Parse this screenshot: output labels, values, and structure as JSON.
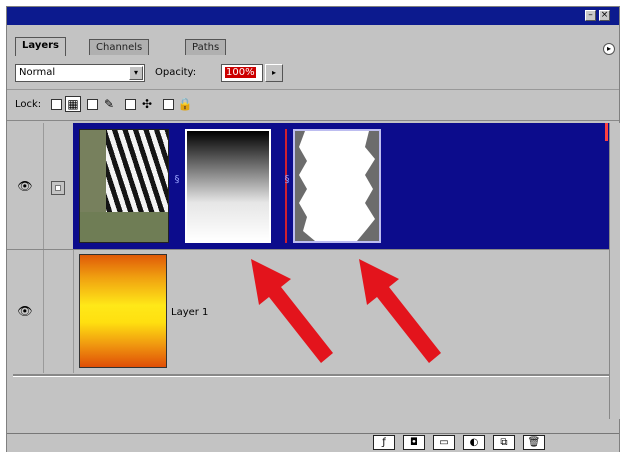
{
  "tabs": [
    "Layers",
    "Channels",
    "Paths"
  ],
  "blend_mode": "Normal",
  "opacity": {
    "label": "Opacity:",
    "value": "100%"
  },
  "lock": {
    "label": "Lock:"
  },
  "layers": [
    {
      "name": "",
      "selected": true,
      "visible": true
    },
    {
      "name": "Layer 1",
      "selected": false,
      "visible": true
    }
  ],
  "colors": {
    "titlebar": "#0c1a8e",
    "selection": "#0c0c8c",
    "panel": "#c3c3c3",
    "arrow": "#e3141c"
  },
  "icons": {
    "window": [
      "minimize-icon",
      "close-icon"
    ],
    "panel_menu": "panel-menu-arrow-icon",
    "lock": [
      "lock-transparency-icon",
      "lock-image-icon",
      "lock-position-icon",
      "lock-all-icon"
    ],
    "bottom": [
      "add-layer-style-icon",
      "add-mask-icon",
      "new-set-icon",
      "new-adjustment-layer-icon",
      "new-layer-icon",
      "trash-icon"
    ]
  }
}
